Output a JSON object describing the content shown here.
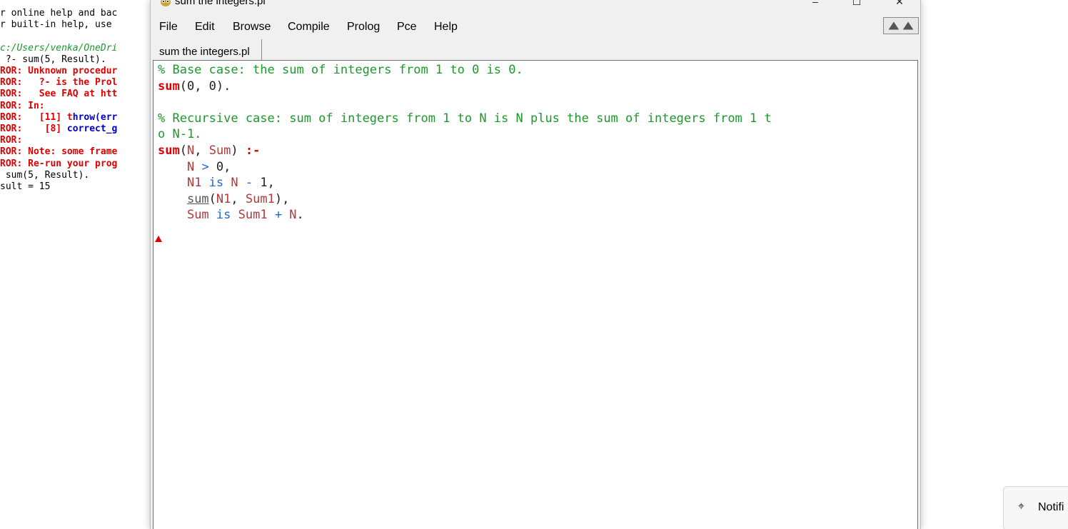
{
  "console": {
    "lines": [
      {
        "text": "r online help and bac",
        "style": "black"
      },
      {
        "text": "r built-in help, use",
        "style": "black"
      },
      {
        "text": "",
        "style": "black"
      },
      {
        "text": "c:/Users/venka/OneDri",
        "style": "green"
      },
      {
        "text": " ?- sum(5, Result).",
        "style": "black"
      },
      {
        "text": "ROR: Unknown procedur",
        "style": "red"
      },
      {
        "text": "ROR:   ?- is the Prol",
        "style": "red"
      },
      {
        "text": "ROR:   See FAQ at htt",
        "style": "red"
      },
      {
        "text": "ROR: In:",
        "style": "red"
      },
      {
        "text": "ROR:   [11] throw(err",
        "style": "red",
        "blue_from": 13
      },
      {
        "text": "ROR:    [8] correct_g",
        "style": "red",
        "blue_from": 12
      },
      {
        "text": "ROR:",
        "style": "red"
      },
      {
        "text": "ROR: Note: some frame",
        "style": "red"
      },
      {
        "text": "ROR: Re-run your prog",
        "style": "red"
      },
      {
        "text": " sum(5, Result).",
        "style": "black"
      },
      {
        "text": "sult = 15",
        "style": "black"
      }
    ]
  },
  "window": {
    "title": "sum the integers.pl",
    "icon": "swi-prolog-owl-icon",
    "controls": {
      "minimize": "–",
      "maximize": "☐",
      "close": "✕"
    }
  },
  "menu": [
    "File",
    "Edit",
    "Browse",
    "Compile",
    "Prolog",
    "Pce",
    "Help"
  ],
  "nav_arrows_icon": "back-forward-arrows-icon",
  "tab": {
    "label": "sum the integers.pl"
  },
  "editor": {
    "lines": [
      [
        {
          "t": "% Base case: the sum of integers from 1 to 0 is 0.",
          "c": "cm"
        }
      ],
      [
        {
          "t": "sum",
          "c": "fn"
        },
        {
          "t": "(0, 0).",
          "c": "pn"
        }
      ],
      [
        {
          "t": "",
          "c": "pn"
        }
      ],
      [
        {
          "t": "% Recursive case: sum of integers from 1 to N is N plus the sum of integers from 1 t",
          "c": "cm"
        }
      ],
      [
        {
          "t": "o N-1.",
          "c": "cm"
        }
      ],
      [
        {
          "t": "sum",
          "c": "fn"
        },
        {
          "t": "(",
          "c": "pn"
        },
        {
          "t": "N",
          "c": "var"
        },
        {
          "t": ", ",
          "c": "pn"
        },
        {
          "t": "Sum",
          "c": "var"
        },
        {
          "t": ") ",
          "c": "pn"
        },
        {
          "t": ":-",
          "c": "fn"
        }
      ],
      [
        {
          "t": "    ",
          "c": "pn"
        },
        {
          "t": "N",
          "c": "var"
        },
        {
          "t": " > ",
          "c": "kw"
        },
        {
          "t": "0,",
          "c": "num"
        }
      ],
      [
        {
          "t": "    ",
          "c": "pn"
        },
        {
          "t": "N1",
          "c": "var"
        },
        {
          "t": " is ",
          "c": "kw"
        },
        {
          "t": "N",
          "c": "var"
        },
        {
          "t": " - ",
          "c": "kw"
        },
        {
          "t": "1,",
          "c": "num"
        }
      ],
      [
        {
          "t": "    ",
          "c": "pn"
        },
        {
          "t": "sum",
          "c": "fnu"
        },
        {
          "t": "(",
          "c": "pn"
        },
        {
          "t": "N1",
          "c": "var"
        },
        {
          "t": ", ",
          "c": "pn"
        },
        {
          "t": "Sum1",
          "c": "var"
        },
        {
          "t": "),",
          "c": "pn"
        }
      ],
      [
        {
          "t": "    ",
          "c": "pn"
        },
        {
          "t": "Sum",
          "c": "var"
        },
        {
          "t": " is ",
          "c": "kw"
        },
        {
          "t": "Sum1",
          "c": "var"
        },
        {
          "t": " + ",
          "c": "kw"
        },
        {
          "t": "N",
          "c": "var"
        },
        {
          "t": ".",
          "c": "pn"
        }
      ]
    ]
  },
  "notification": {
    "icon": "notification-pin-icon",
    "label": "Notifi"
  }
}
